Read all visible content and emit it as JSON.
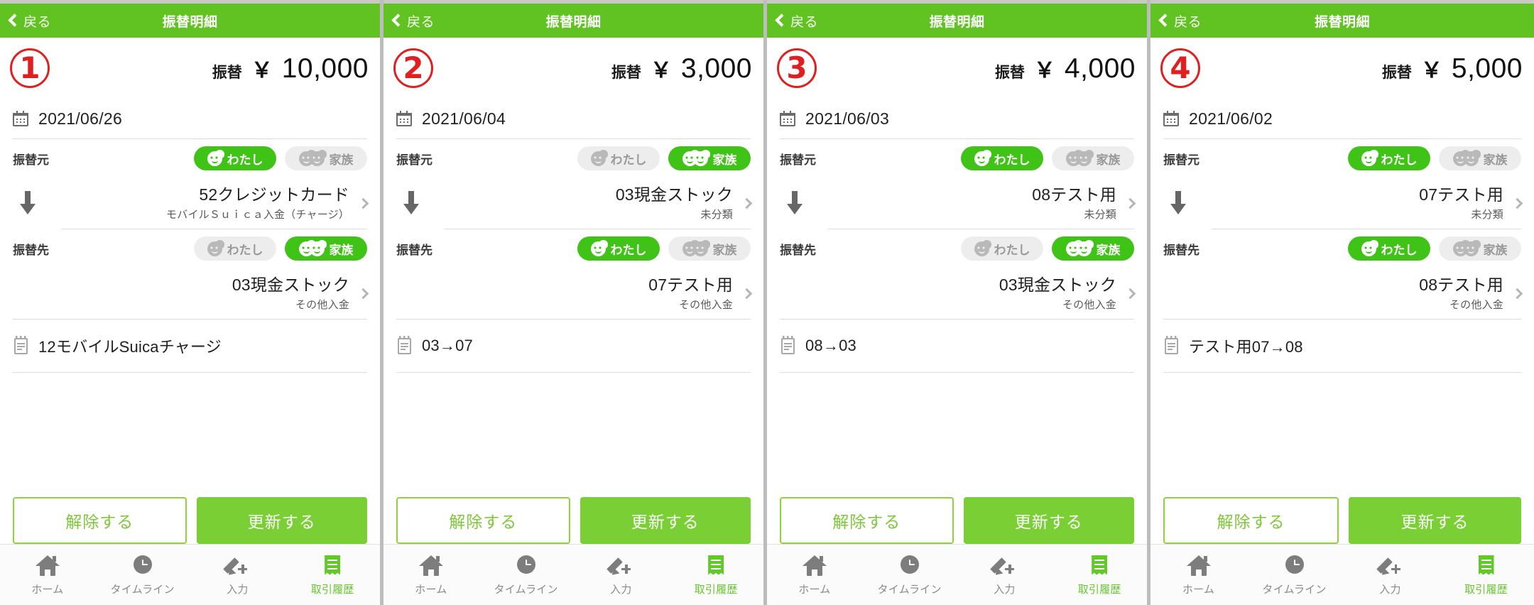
{
  "app": {
    "nav_title": "振替明細",
    "back_label": "戻る",
    "accent_green": "#61c322",
    "pill_green": "#3fc316",
    "badge_red": "#e02020"
  },
  "labels": {
    "amount_label": "振替",
    "yen_symbol": "￥",
    "source_label": "振替元",
    "dest_label": "振替先",
    "me_label": "わたし",
    "family_label": "家族",
    "release_button": "解除する",
    "update_button": "更新する"
  },
  "tabbar": {
    "items": [
      {
        "label": "ホーム",
        "icon": "home-icon",
        "active": false
      },
      {
        "label": "タイムライン",
        "icon": "clock-icon",
        "active": false
      },
      {
        "label": "入力",
        "icon": "pencil-plus-icon",
        "active": false
      },
      {
        "label": "取引履歴",
        "icon": "receipt-icon",
        "active": true
      }
    ]
  },
  "panels": [
    {
      "badge": "1",
      "amount": "10,000",
      "date": "2021/06/26",
      "source": {
        "selected": "me",
        "account_name": "52クレジットカード",
        "account_category": "モバイルＳｕｉｃａ入金（チャージ）"
      },
      "dest": {
        "selected": "family",
        "account_name": "03現金ストック",
        "account_category": "その他入金"
      },
      "memo": "12モバイルSuicaチャージ"
    },
    {
      "badge": "2",
      "amount": "3,000",
      "date": "2021/06/04",
      "source": {
        "selected": "family",
        "account_name": "03現金ストック",
        "account_category": "未分類"
      },
      "dest": {
        "selected": "me",
        "account_name": "07テスト用",
        "account_category": "その他入金"
      },
      "memo": "03→07"
    },
    {
      "badge": "3",
      "amount": "4,000",
      "date": "2021/06/03",
      "source": {
        "selected": "me",
        "account_name": "08テスト用",
        "account_category": "未分類"
      },
      "dest": {
        "selected": "family",
        "account_name": "03現金ストック",
        "account_category": "その他入金"
      },
      "memo": "08→03"
    },
    {
      "badge": "4",
      "amount": "5,000",
      "date": "2021/06/02",
      "source": {
        "selected": "me",
        "account_name": "07テスト用",
        "account_category": "未分類"
      },
      "dest": {
        "selected": "me",
        "account_name": "08テスト用",
        "account_category": "その他入金"
      },
      "memo": "テスト用07→08"
    }
  ]
}
